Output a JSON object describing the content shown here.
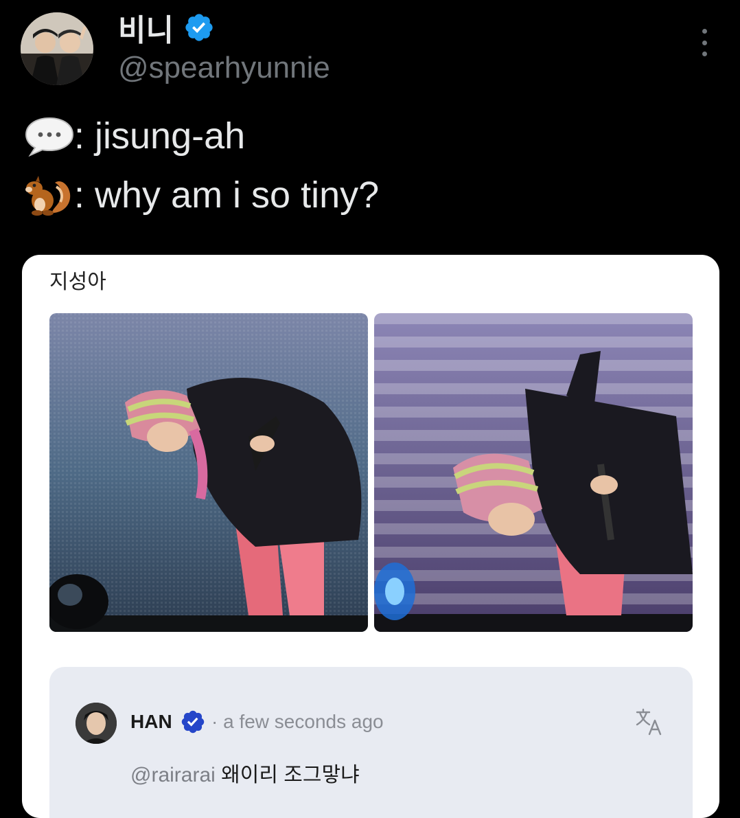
{
  "author": {
    "display_name": "비니",
    "handle": "@spearhyunnie",
    "verified_icon": "verified-badge-icon",
    "avatar_icon": "profile-avatar"
  },
  "tweet": {
    "line1": {
      "emoji": "speech-balloon-emoji",
      "text": ": jisung-ah"
    },
    "line2": {
      "emoji": "chipmunk-emoji",
      "text": ": why am i so tiny?"
    }
  },
  "card": {
    "title": "지성아",
    "photos": [
      "stage-photo-left",
      "stage-photo-right"
    ],
    "comment": {
      "author": "HAN",
      "time": "· a few seconds ago",
      "mention": "@rairarai",
      "text": " 왜이리 조그맣냐",
      "translate_icon": "translate-icon"
    }
  },
  "colors": {
    "background": "#000000",
    "text_primary": "#e7e9ea",
    "text_secondary": "#71767b",
    "verified_blue": "#1d9bf0",
    "card_bg": "#ffffff",
    "comment_bg": "#e8ebf2"
  }
}
